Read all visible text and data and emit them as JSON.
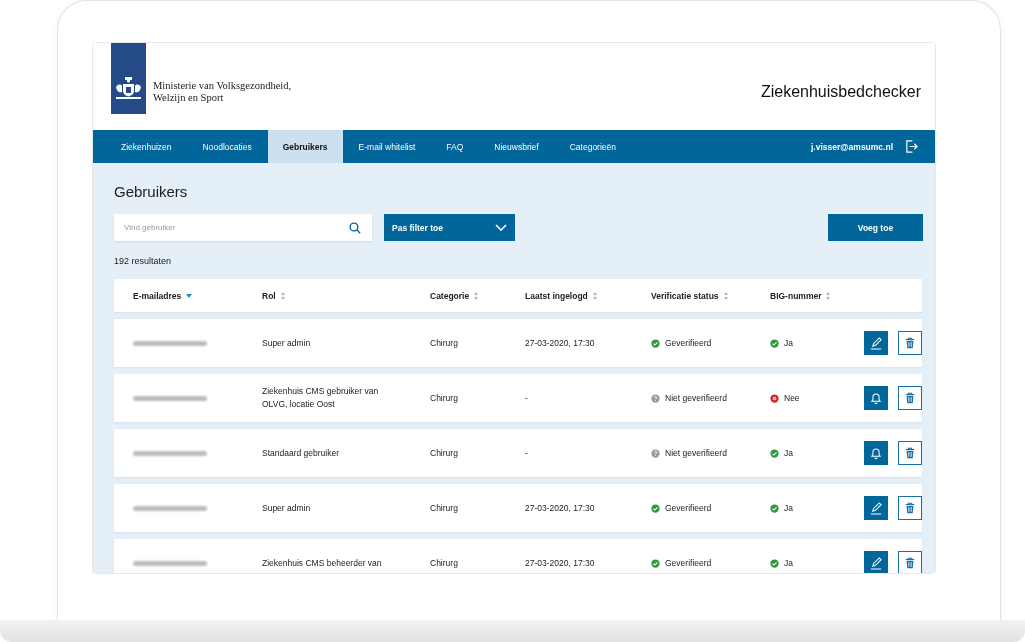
{
  "header": {
    "ministry_name": [
      "Ministerie van Volksgezondheid,",
      "Welzijn en Sport"
    ],
    "app_title": "Ziekenhuisbedchecker"
  },
  "nav": {
    "tabs": [
      {
        "label": "Ziekenhuizen",
        "selected": false
      },
      {
        "label": "Noodlocaties",
        "selected": false
      },
      {
        "label": "Gebruikers",
        "selected": true
      },
      {
        "label": "E-mail whitelist",
        "selected": false
      },
      {
        "label": "FAQ",
        "selected": false
      },
      {
        "label": "Nieuwsbrief",
        "selected": false
      },
      {
        "label": "Categorieën",
        "selected": false
      }
    ],
    "user_email": "j.visser@amsumc.nl"
  },
  "page": {
    "title": "Gebruikers",
    "search": {
      "placeholder": "Vind gebruiker"
    },
    "filter_button": "Pas filter toe",
    "add_button": "Voeg toe",
    "result_count": "192 resultaten"
  },
  "table": {
    "columns": [
      {
        "label": "E-mailadres",
        "sorted": true
      },
      {
        "label": "Rol",
        "sorted": false
      },
      {
        "label": "Categorie",
        "sorted": false
      },
      {
        "label": "Laatst ingelogd",
        "sorted": false
      },
      {
        "label": "Verificatie status",
        "sorted": false
      },
      {
        "label": "BIG-nummer",
        "sorted": false
      }
    ],
    "rows": [
      {
        "role": "Super admin",
        "category": "Chirurg",
        "last_login": "27-03-2020, 17:30",
        "verification": {
          "kind": "verified",
          "label": "Geverifieerd"
        },
        "big": {
          "kind": "yes",
          "label": "Ja"
        },
        "action": {
          "kind": "edit"
        }
      },
      {
        "role": "Ziekenhuis CMS gebruiker van OLVG, locatie Oost",
        "category": "Chirurg",
        "last_login": "-",
        "verification": {
          "kind": "unverified",
          "label": "Niet geverifieerd"
        },
        "big": {
          "kind": "no",
          "label": "Nee"
        },
        "action": {
          "kind": "notify"
        }
      },
      {
        "role": "Standaard gebruiker",
        "category": "Chirurg",
        "last_login": "-",
        "verification": {
          "kind": "unverified",
          "label": "Niet geverifieerd"
        },
        "big": {
          "kind": "yes",
          "label": "Ja"
        },
        "action": {
          "kind": "notify"
        }
      },
      {
        "role": "Super admin",
        "category": "Chirurg",
        "last_login": "27-03-2020, 17:30",
        "verification": {
          "kind": "verified",
          "label": "Geverifieerd"
        },
        "big": {
          "kind": "yes",
          "label": "Ja"
        },
        "action": {
          "kind": "edit"
        }
      },
      {
        "role": "Ziekenhuis CMS beheerder van",
        "category": "Chirurg",
        "last_login": "27-03-2020, 17:30",
        "verification": {
          "kind": "verified",
          "label": "Geverifieerd"
        },
        "big": {
          "kind": "yes",
          "label": "Ja"
        },
        "action": {
          "kind": "edit"
        }
      }
    ]
  }
}
